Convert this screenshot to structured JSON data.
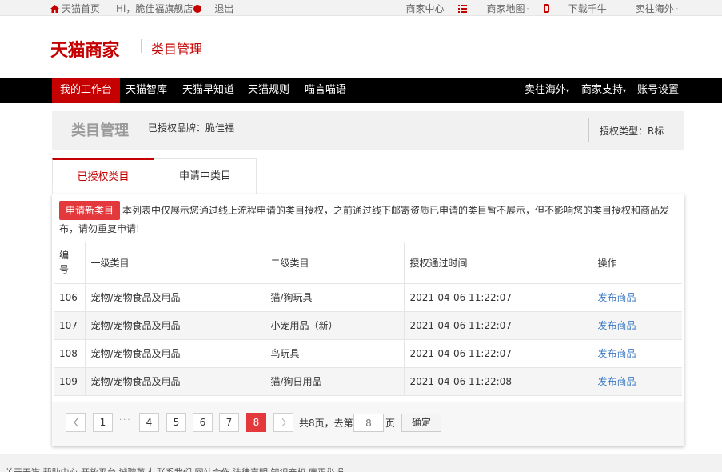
{
  "topbar": {
    "home": "天猫首页",
    "greeting": "Hi，脆佳福旗舰店",
    "logout": "退出",
    "merchant_center": "商家中心",
    "merchant_map": "商家地图",
    "download": "下载千牛",
    "sell_abroad": "卖往海外"
  },
  "header": {
    "brand": "天猫商家",
    "subtitle": "类目管理"
  },
  "nav": {
    "left": [
      "我的工作台",
      "天猫智库",
      "天猫早知道",
      "天猫规则",
      "喵言喵语"
    ],
    "right": [
      "卖往海外",
      "商家支持",
      "账号设置"
    ]
  },
  "page_header": {
    "title": "类目管理",
    "authorized_brand": "已授权品牌：脆佳福",
    "auth_type": "授权类型：R标"
  },
  "tabs": [
    "已授权类目",
    "申请中类目"
  ],
  "notice": {
    "button": "申请新类目",
    "text": "本列表中仅展示您通过线上流程申请的类目授权，之前通过线下邮寄资质已申请的类目暂不展示，但不影响您的类目授权和商品发布，请勿重复申请!"
  },
  "table": {
    "headers": [
      "编号",
      "一级类目",
      "二级类目",
      "授权通过时间",
      "操作"
    ],
    "rows": [
      {
        "id": "106",
        "cat1": "宠物/宠物食品及用品",
        "cat2": "猫/狗玩具",
        "time": "2021-04-06 11:22:07",
        "action": "发布商品"
      },
      {
        "id": "107",
        "cat1": "宠物/宠物食品及用品",
        "cat2": "小宠用品（新）",
        "time": "2021-04-06 11:22:07",
        "action": "发布商品"
      },
      {
        "id": "108",
        "cat1": "宠物/宠物食品及用品",
        "cat2": "鸟玩具",
        "time": "2021-04-06 11:22:07",
        "action": "发布商品"
      },
      {
        "id": "109",
        "cat1": "宠物/宠物食品及用品",
        "cat2": "猫/狗日用品",
        "time": "2021-04-06 11:22:08",
        "action": "发布商品"
      }
    ]
  },
  "pagination": {
    "pages": [
      "1",
      "4",
      "5",
      "6",
      "7",
      "8"
    ],
    "current": "8",
    "total_text": "共8页，去第",
    "input_placeholder": "8",
    "suffix": "页",
    "confirm": "确定"
  },
  "footer": {
    "text": "关于天猫  帮助中心  开放平台  诚聘英才  联系我们  网站合作  法律声明  知识产权  廉正举报"
  },
  "colors": {
    "brand_red": "#c40000",
    "accent_red": "#e4393c",
    "link_blue": "#3a78c3"
  }
}
